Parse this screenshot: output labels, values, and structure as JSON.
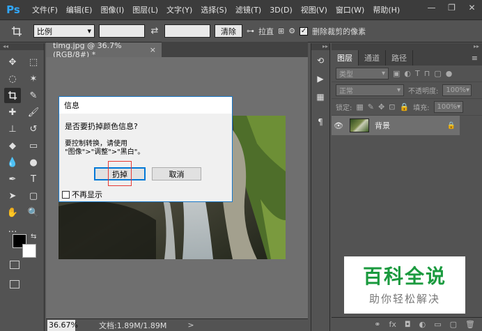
{
  "app": {
    "logo": "Ps"
  },
  "menu": [
    "文件(F)",
    "编辑(E)",
    "图像(I)",
    "图层(L)",
    "文字(Y)",
    "选择(S)",
    "滤镜(T)",
    "3D(D)",
    "视图(V)",
    "窗口(W)",
    "帮助(H)"
  ],
  "window_controls": {
    "minimize": "—",
    "restore": "❐",
    "close": "✕"
  },
  "options_bar": {
    "tool_icon": "crop-icon",
    "ratio_select": "比例",
    "swap_icon": "⇄",
    "clear_button": "清除",
    "straighten_label": "拉直",
    "delete_cropped_label": "删除裁剪的像素",
    "delete_cropped_checked": true
  },
  "document": {
    "tab_title": "timg.jpg @ 36.7%(RGB/8#) *",
    "tab_close": "×",
    "zoom": "36.67%",
    "doc_info": "文档:1.89M/1.89M",
    "status_arrow": ">"
  },
  "dialog": {
    "title": "信息",
    "question": "是否要扔掉颜色信息?",
    "hint_line1": "要控制转换，请使用",
    "hint_line2": "\"图像\">\"调整\">\"黑白\"。",
    "discard_button": "扔掉",
    "cancel_button": "取消",
    "dont_show_label": "不再显示"
  },
  "layers_panel": {
    "tabs": [
      "图层",
      "通道",
      "路径"
    ],
    "active_tab": 0,
    "menu_icon": "≡",
    "filter_label": "类型",
    "blend_mode": "正常",
    "opacity_label": "不透明度:",
    "opacity_value": "100%",
    "lock_label": "锁定:",
    "fill_label": "填充:",
    "fill_value": "100%",
    "layers": [
      {
        "name": "背景",
        "visible": true,
        "locked": true
      }
    ],
    "bottom_icons": [
      "link-icon",
      "fx-icon",
      "mask-icon",
      "adjustment-icon",
      "folder-icon",
      "new-layer-icon",
      "trash-icon"
    ]
  },
  "watermark": {
    "title": "百科全说",
    "subtitle": "助你轻松解决"
  },
  "colors": {
    "accent": "#31a8ff",
    "dialog_border": "#0078d7",
    "highlight": "#e53935",
    "watermark_green": "#1a9a3e"
  }
}
